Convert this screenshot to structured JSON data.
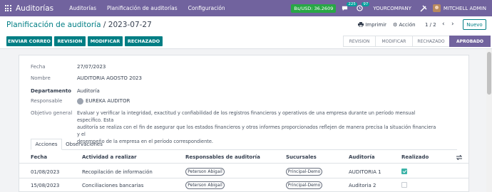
{
  "navbar": {
    "brand": "Auditorías",
    "menu": [
      "Auditorías",
      "Planificación de auditorías",
      "Configuración"
    ],
    "rate": "Bs/USD: 36.2609",
    "messages_count": "225",
    "activities_count": "97",
    "company": "YOURCOMPANY",
    "user": "MITCHELL ADMIN"
  },
  "control": {
    "breadcrumb_parent": "Planificación de auditoría",
    "breadcrumb_separator": "/",
    "breadcrumb_current": "2023-07-27",
    "print_label": "Imprimir",
    "action_label": "Acción",
    "pager": "1 / 2",
    "new_label": "Nuevo",
    "buttons": [
      "ENVIAR CORREO",
      "REVISION",
      "MODIFICAR",
      "RECHAZADO"
    ],
    "stages": [
      "REVISION",
      "MODIFICAR",
      "RECHAZADO",
      "APROBADO"
    ]
  },
  "form": {
    "fecha_label": "Fecha",
    "fecha_value": "27/07/2023",
    "nombre_label": "Nombre",
    "nombre_value": "AUDITORIA AGOSTO 2023",
    "departamento_label": "Departamento",
    "departamento_value": "Auditoría",
    "responsable_label": "Responsable",
    "responsable_value": "EUREKA AUDITOR",
    "objetivo_label": "Objetivo general",
    "objetivo_lines": [
      "Evaluar y verificar la integridad, exactitud y confiabilidad de los registros financieros y operativos de una empresa durante un período mensual específico. Esta",
      "auditoría se realiza con el fin de asegurar que los estados financieros y otros informes proporcionados reflejen de manera precisa la situación financiera y el",
      "desempeño de la empresa en el período correspondiente."
    ]
  },
  "tabs": [
    "Acciones",
    "Observaciones"
  ],
  "table": {
    "headers": [
      "Fecha",
      "Actividad a realizar",
      "Responsables de auditoría",
      "Sucursales",
      "Auditoría",
      "Realizado"
    ],
    "rows": [
      {
        "fecha": "01/08/2023",
        "actividad": "Recopilación de información",
        "responsable": "Peterson Abigail",
        "sucursal": "Principal-Demo",
        "auditoria": "AUDITORIA 1",
        "realizado": true
      },
      {
        "fecha": "15/08/2023",
        "actividad": "Conciliaciones bancarias",
        "responsable": "Peterson Abigail",
        "sucursal": "Principal-Demo",
        "auditoria": "Auditoria 2",
        "realizado": false
      }
    ]
  },
  "colors": {
    "navbar": "#71639e",
    "primary": "#017e84",
    "rate_badge": "#28a745",
    "checkbox_on": "#3cb3a8"
  }
}
